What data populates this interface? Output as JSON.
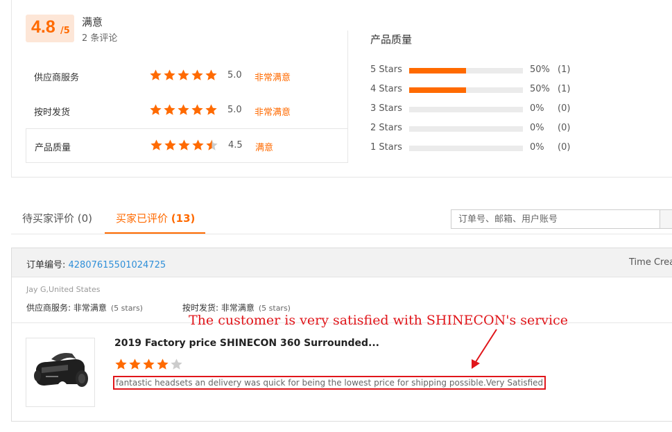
{
  "summary": {
    "score": "4.8",
    "score_out_of": "/5",
    "satisfaction": "满意",
    "review_count": "2 条评论"
  },
  "ratings": [
    {
      "label": "供应商服务",
      "stars": 5.0,
      "score": "5.0",
      "level": "非常满意"
    },
    {
      "label": "按时发货",
      "stars": 5.0,
      "score": "5.0",
      "level": "非常满意"
    },
    {
      "label": "产品质量",
      "stars": 4.5,
      "score": "4.5",
      "level": "满意"
    }
  ],
  "distribution": {
    "title": "产品质量",
    "rows": [
      {
        "label": "5  Stars",
        "fraction": 0.5,
        "pct": "50%",
        "count": "(1)"
      },
      {
        "label": "4  Stars",
        "fraction": 0.5,
        "pct": "50%",
        "count": "(1)"
      },
      {
        "label": "3  Stars",
        "fraction": 0,
        "pct": "0%",
        "count": "(0)"
      },
      {
        "label": "2  Stars",
        "fraction": 0,
        "pct": "0%",
        "count": "(0)"
      },
      {
        "label": "1  Stars",
        "fraction": 0,
        "pct": "0%",
        "count": "(0)"
      }
    ]
  },
  "tabs": [
    {
      "label": "待买家评价 (0)"
    },
    {
      "label": "买家已评价 ",
      "count": "(13)"
    }
  ],
  "search": {
    "placeholder": "订单号、邮箱、用户账号"
  },
  "order": {
    "label": "订单编号: ",
    "number": "42807615501024725",
    "time_label": "Time Crea",
    "buyer": "Jay G,United States",
    "service_rating": {
      "label": "供应商服务: 非常满意",
      "stars_note": "(5 stars)"
    },
    "shipping_rating": {
      "label": "按时发货: 非常满意",
      "stars_note": "(5 stars)"
    },
    "product_title": "2019 Factory price SHINECON 360 Surrounded...",
    "review_stars": 4,
    "review_text": "fantastic headsets an delivery was quick for being the lowest price for shipping possible.Very Satisfied"
  },
  "annotation": "The customer is very satisfied with SHINECON's service",
  "colors": {
    "accent": "#ff6a00",
    "link": "#2f8fd8",
    "annotation": "#e0151a",
    "star_empty": "#cccccc"
  }
}
